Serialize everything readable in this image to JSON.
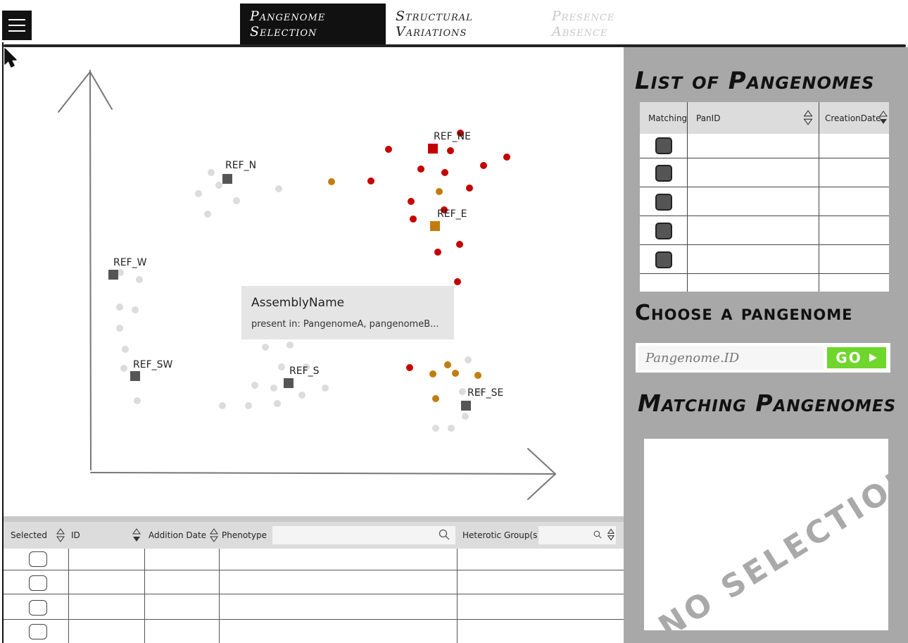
{
  "tabs": [
    {
      "label": "Pangenome Selection",
      "state": "active"
    },
    {
      "label": "Structural Variations",
      "state": "normal"
    },
    {
      "label": "Presence Absence",
      "state": "disabled"
    }
  ],
  "plot": {
    "references": [
      {
        "label": "REF_NE"
      },
      {
        "label": "REF_N"
      },
      {
        "label": "REF_E"
      },
      {
        "label": "REF_W"
      },
      {
        "label": "REF_SW"
      },
      {
        "label": "REF_S"
      },
      {
        "label": "REF_SE"
      }
    ],
    "tooltip": {
      "title": "AssemblyName",
      "subtitle": "present in: PangenomeA, pangenomeB..."
    },
    "colors": {
      "red": "#c40000",
      "orange": "#c27c0e",
      "gray": "#dcdcdc",
      "ref_gray": "#555555"
    }
  },
  "bottom_table": {
    "headers": {
      "selected": "Selected",
      "id": "ID",
      "addition_date": "Addition Date",
      "phenotype": "Phenotype",
      "heterotic_groups": "Heterotic Group(s)"
    },
    "rows": [
      {},
      {},
      {},
      {}
    ]
  },
  "right_panel": {
    "list_title": "List of Pangenomes",
    "table_headers": {
      "matching": "Matching",
      "panid": "PanID",
      "creation_date": "CreationDate"
    },
    "rows": [
      {},
      {},
      {},
      {},
      {}
    ],
    "choose_title": "Choose a pangenome",
    "input_placeholder": "Pangenome.ID",
    "go_label": "GO",
    "matching_title": "Matching Pangenomes",
    "no_selection": "NO SELECTION"
  }
}
